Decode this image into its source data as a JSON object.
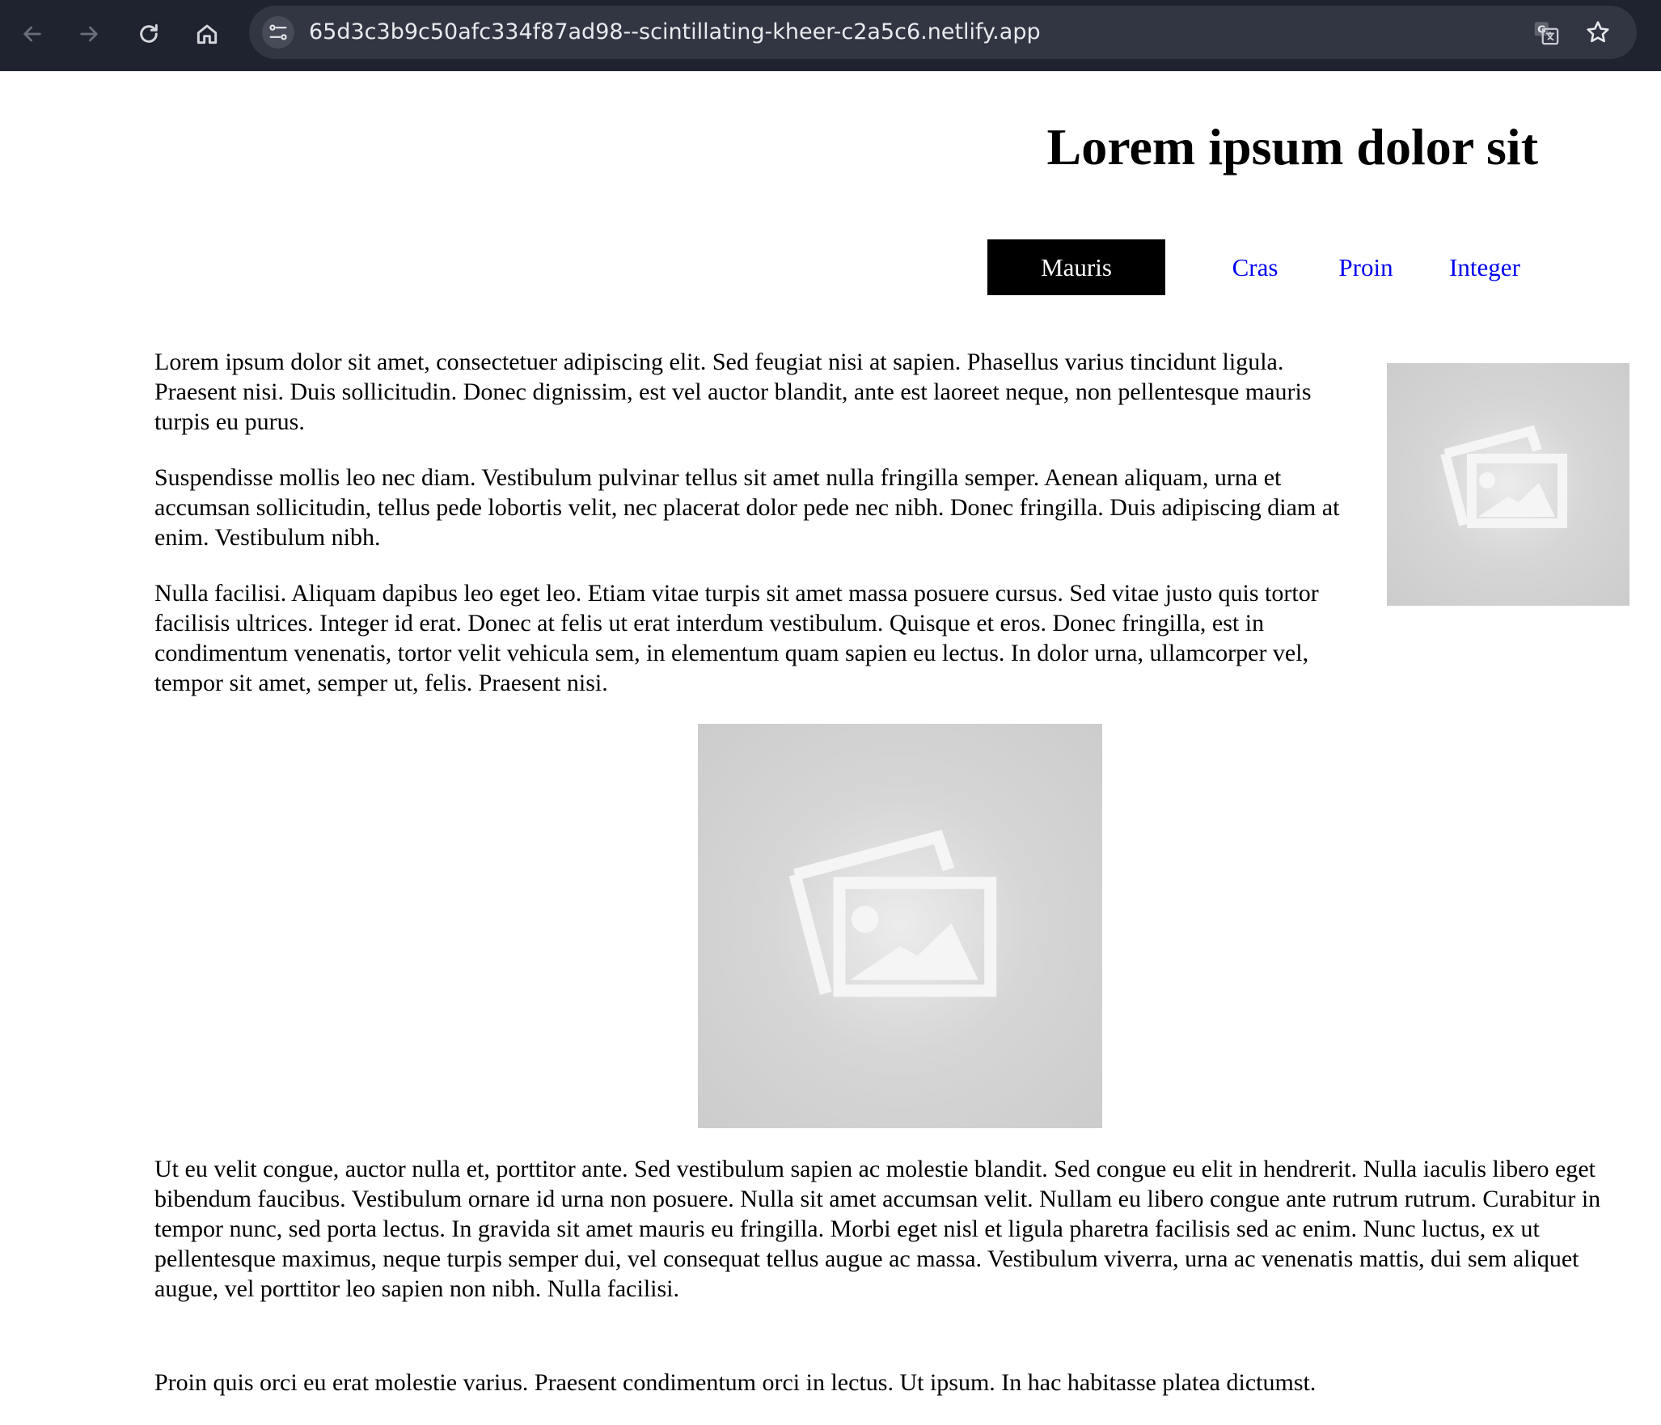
{
  "browser": {
    "url": "65d3c3b9c50afc334f87ad98--scintillating-kheer-c2a5c6.netlify.app",
    "icons": [
      "back-arrow-icon",
      "forward-arrow-icon",
      "reload-icon",
      "home-icon",
      "site-info-icon",
      "translate-icon",
      "bookmark-star-icon"
    ]
  },
  "page": {
    "title": "Lorem ipsum dolor sit",
    "nav": [
      {
        "label": "Mauris",
        "active": true
      },
      {
        "label": "Cras",
        "active": false
      },
      {
        "label": "Proin",
        "active": false
      },
      {
        "label": "Integer",
        "active": false
      }
    ],
    "paragraphs": [
      "Lorem ipsum dolor sit amet, consectetuer adipiscing elit. Sed feugiat nisi at sapien. Phasellus varius tincidunt ligula. Praesent nisi. Duis sollicitudin. Donec dignissim, est vel auctor blandit, ante est laoreet neque, non pellentesque mauris turpis eu purus.",
      "Suspendisse mollis leo nec diam. Vestibulum pulvinar tellus sit amet nulla fringilla semper. Aenean aliquam, urna et accumsan sollicitudin, tellus pede lobortis velit, nec placerat dolor pede nec nibh. Donec fringilla. Duis adipiscing diam at enim. Vestibulum nibh.",
      "Nulla facilisi. Aliquam dapibus leo eget leo. Etiam vitae turpis sit amet massa posuere cursus. Sed vitae justo quis tortor facilisis ultrices. Integer id erat. Donec at felis ut erat interdum vestibulum. Quisque et eros. Donec fringilla, est in condimentum venenatis, tortor velit vehicula sem, in elementum quam sapien eu lectus. In dolor urna, ullamcorper vel, tempor sit amet, semper ut, felis. Praesent nisi.",
      "Ut eu velit congue, auctor nulla et, porttitor ante. Sed vestibulum sapien ac molestie blandit. Sed congue eu elit in hendrerit. Nulla iaculis libero eget bibendum faucibus. Vestibulum ornare id urna non posuere. Nulla sit amet accumsan velit. Nullam eu libero congue ante rutrum rutrum. Curabitur in tempor nunc, sed porta lectus. In gravida sit amet mauris eu fringilla. Morbi eget nisl et ligula pharetra facilisis sed ac enim. Nunc luctus, ex ut pellentesque maximus, neque turpis semper dui, vel consequat tellus augue ac massa. Vestibulum viverra, urna ac venenatis mattis, dui sem aliquet augue, vel porttitor leo sapien non nibh. Nulla facilisi.",
      "Proin quis orci eu erat molestie varius. Praesent condimentum orci in lectus. Ut ipsum. In hac habitasse platea dictumst."
    ],
    "images": [
      "image-placeholder-icon",
      "image-placeholder-icon"
    ]
  },
  "colors": {
    "chrome_bg": "#1f2330",
    "omnibox_bg": "#323643",
    "link": "#0000ee",
    "active_nav_bg": "#000000",
    "placeholder_bg": "#cccccc"
  }
}
